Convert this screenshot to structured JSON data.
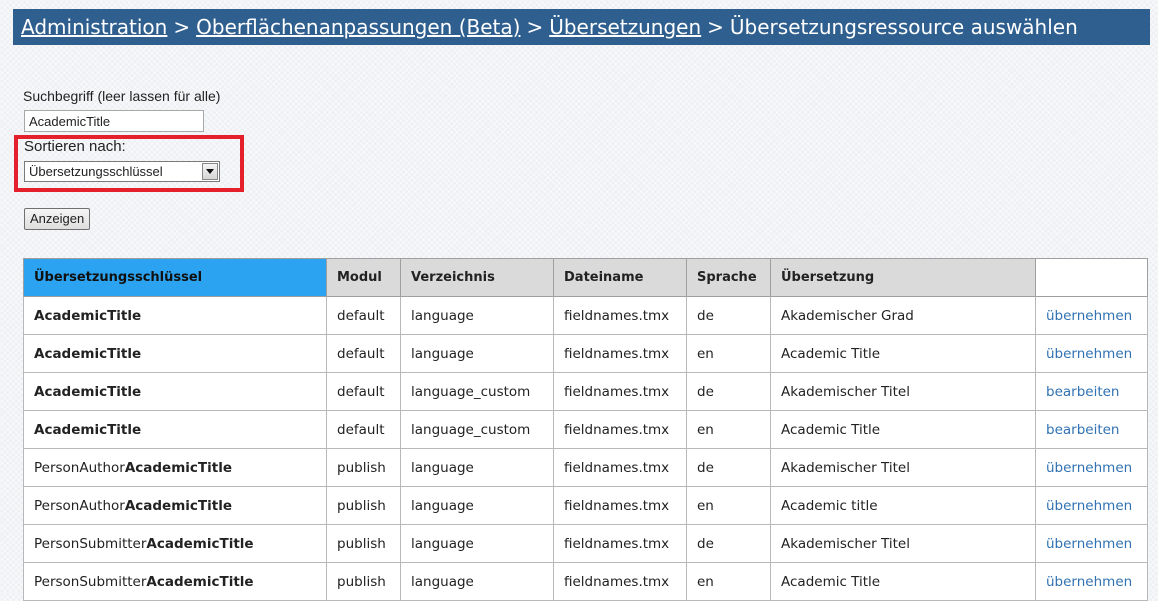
{
  "breadcrumb": {
    "items": [
      "Administration",
      "Oberflächenanpassungen (Beta)",
      "Übersetzungen"
    ],
    "separator": ">",
    "current": "Übersetzungsressource auswählen"
  },
  "search": {
    "label": "Suchbegriff (leer lassen für alle)",
    "value": "AcademicTitle"
  },
  "sort": {
    "label": "Sortieren nach:",
    "selected": "Übersetzungsschlüssel"
  },
  "show_button": "Anzeigen",
  "table": {
    "headers": [
      "Übersetzungsschlüssel",
      "Modul",
      "Verzeichnis",
      "Dateiname",
      "Sprache",
      "Übersetzung",
      ""
    ],
    "rows": [
      {
        "key_prefix": "",
        "key_bold": "AcademicTitle",
        "module": "default",
        "dir": "language",
        "file": "fieldnames.tmx",
        "lang": "de",
        "translation": "Akademischer Grad",
        "action": "übernehmen"
      },
      {
        "key_prefix": "",
        "key_bold": "AcademicTitle",
        "module": "default",
        "dir": "language",
        "file": "fieldnames.tmx",
        "lang": "en",
        "translation": "Academic Title",
        "action": "übernehmen"
      },
      {
        "key_prefix": "",
        "key_bold": "AcademicTitle",
        "module": "default",
        "dir": "language_custom",
        "file": "fieldnames.tmx",
        "lang": "de",
        "translation": "Akademischer Titel",
        "action": "bearbeiten"
      },
      {
        "key_prefix": "",
        "key_bold": "AcademicTitle",
        "module": "default",
        "dir": "language_custom",
        "file": "fieldnames.tmx",
        "lang": "en",
        "translation": "Academic Title",
        "action": "bearbeiten"
      },
      {
        "key_prefix": "PersonAuthor",
        "key_bold": "AcademicTitle",
        "module": "publish",
        "dir": "language",
        "file": "fieldnames.tmx",
        "lang": "de",
        "translation": "Akademischer Titel",
        "action": "übernehmen"
      },
      {
        "key_prefix": "PersonAuthor",
        "key_bold": "AcademicTitle",
        "module": "publish",
        "dir": "language",
        "file": "fieldnames.tmx",
        "lang": "en",
        "translation": "Academic title",
        "action": "übernehmen"
      },
      {
        "key_prefix": "PersonSubmitter",
        "key_bold": "AcademicTitle",
        "module": "publish",
        "dir": "language",
        "file": "fieldnames.tmx",
        "lang": "de",
        "translation": "Akademischer Titel",
        "action": "übernehmen"
      },
      {
        "key_prefix": "PersonSubmitter",
        "key_bold": "AcademicTitle",
        "module": "publish",
        "dir": "language",
        "file": "fieldnames.tmx",
        "lang": "en",
        "translation": "Academic Title",
        "action": "übernehmen"
      }
    ]
  },
  "colors": {
    "titlebar_bg": "#2f5f8f",
    "active_header": "#2ba3f0",
    "highlight_box": "#e3202c",
    "link": "#3072b3"
  },
  "icons": {
    "select_arrow": "chevron-down-icon"
  }
}
